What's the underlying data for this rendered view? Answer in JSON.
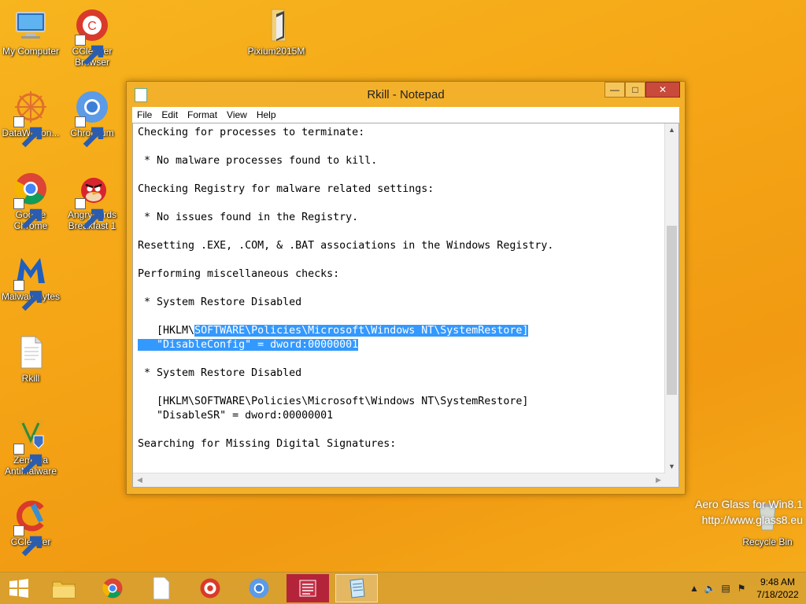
{
  "desktop": {
    "icons": [
      {
        "label": "My Computer"
      },
      {
        "label": "CCleaner Browser"
      },
      {
        "label": "Pixium2015M"
      },
      {
        "label": "DataWagon..."
      },
      {
        "label": "Chromium"
      },
      {
        "label": "Google Chrome"
      },
      {
        "label": "Angry Birds Breakfast 1"
      },
      {
        "label": "Malwarebytes"
      },
      {
        "label": "Rkill"
      },
      {
        "label": "Zemana AntiMalware"
      },
      {
        "label": "CCleaner"
      },
      {
        "label": "Recycle Bin"
      }
    ],
    "watermark": {
      "line1": "Aero Glass for Win8.1",
      "line2": "http://www.glass8.eu"
    }
  },
  "window": {
    "title": "Rkill - Notepad",
    "menu": [
      "File",
      "Edit",
      "Format",
      "View",
      "Help"
    ],
    "lines": [
      {
        "pre": "Checking for processes to terminate:",
        "sel": "",
        "post": ""
      },
      {
        "pre": "",
        "sel": "",
        "post": ""
      },
      {
        "pre": " * No malware processes found to kill.",
        "sel": "",
        "post": ""
      },
      {
        "pre": "",
        "sel": "",
        "post": ""
      },
      {
        "pre": "Checking Registry for malware related settings:",
        "sel": "",
        "post": ""
      },
      {
        "pre": "",
        "sel": "",
        "post": ""
      },
      {
        "pre": " * No issues found in the Registry.",
        "sel": "",
        "post": ""
      },
      {
        "pre": "",
        "sel": "",
        "post": ""
      },
      {
        "pre": "Resetting .EXE, .COM, & .BAT associations in the Windows Registry.",
        "sel": "",
        "post": ""
      },
      {
        "pre": "",
        "sel": "",
        "post": ""
      },
      {
        "pre": "Performing miscellaneous checks:",
        "sel": "",
        "post": ""
      },
      {
        "pre": "",
        "sel": "",
        "post": ""
      },
      {
        "pre": " * System Restore Disabled",
        "sel": "",
        "post": ""
      },
      {
        "pre": "",
        "sel": "",
        "post": ""
      },
      {
        "pre": "   [HKLM\\",
        "sel": "SOFTWARE\\Policies\\Microsoft\\Windows NT\\SystemRestore]",
        "post": ""
      },
      {
        "pre": "",
        "sel": "   \"DisableConfig\" = dword:00000001",
        "post": ""
      },
      {
        "pre": "",
        "sel": "",
        "post": ""
      },
      {
        "pre": " * System Restore Disabled",
        "sel": "",
        "post": ""
      },
      {
        "pre": "",
        "sel": "",
        "post": ""
      },
      {
        "pre": "   [HKLM\\SOFTWARE\\Policies\\Microsoft\\Windows NT\\SystemRestore]",
        "sel": "",
        "post": ""
      },
      {
        "pre": "   \"DisableSR\" = dword:00000001",
        "sel": "",
        "post": ""
      },
      {
        "pre": "",
        "sel": "",
        "post": ""
      },
      {
        "pre": "Searching for Missing Digital Signatures:",
        "sel": "",
        "post": ""
      }
    ]
  },
  "taskbar": {
    "time": "9:48 AM",
    "date": "7/18/2022"
  }
}
